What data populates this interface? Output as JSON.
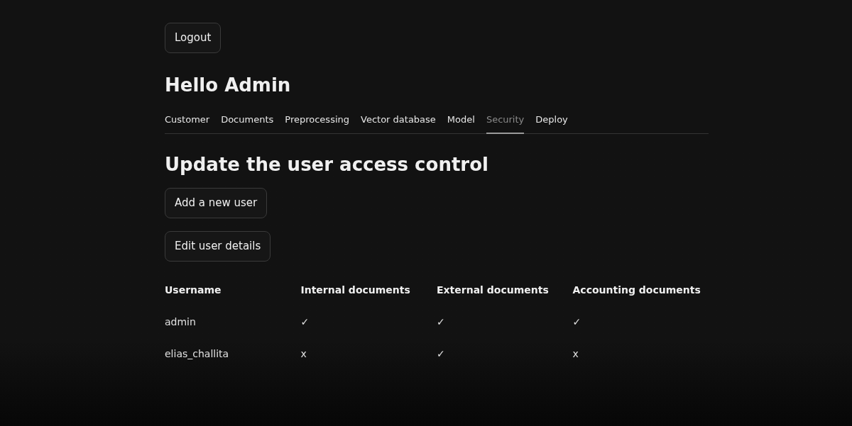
{
  "logout_button": "Logout",
  "heading": "Hello Admin",
  "tabs": [
    {
      "label": "Customer",
      "selected": false
    },
    {
      "label": "Documents",
      "selected": false
    },
    {
      "label": "Preprocessing",
      "selected": false
    },
    {
      "label": "Vector database",
      "selected": false
    },
    {
      "label": "Model",
      "selected": false
    },
    {
      "label": "Security",
      "selected": true
    },
    {
      "label": "Deploy",
      "selected": false
    }
  ],
  "section_title": "Update the user access control",
  "buttons": [
    "Add a new user",
    "Edit user details"
  ],
  "table": {
    "columns": [
      "Username",
      "Internal documents",
      "External documents",
      "Accounting documents"
    ],
    "rows": [
      [
        "admin",
        "✓",
        "✓",
        "✓"
      ],
      [
        "elias_challita",
        "x",
        "✓",
        "x"
      ]
    ]
  }
}
